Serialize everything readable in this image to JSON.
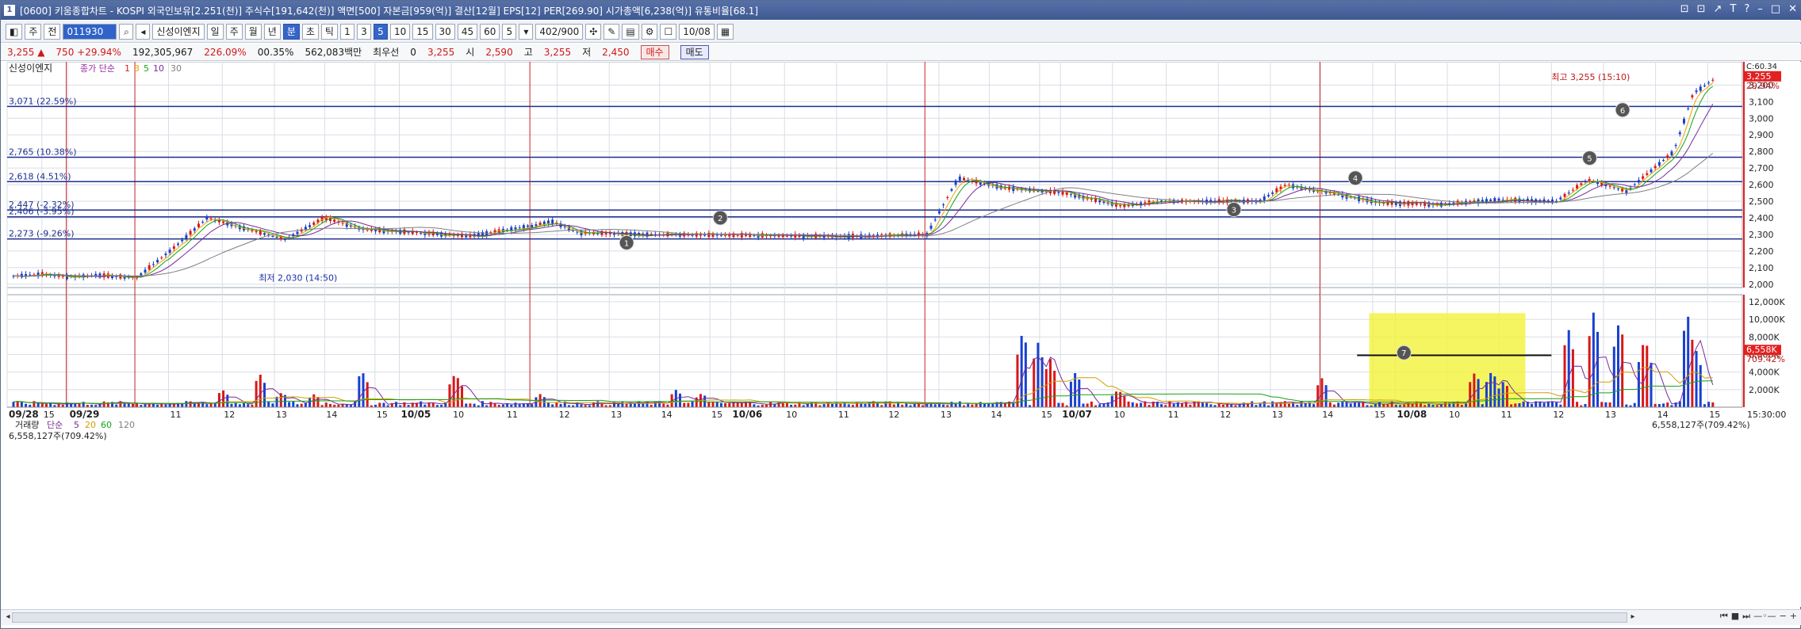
{
  "window": {
    "title": "[0600] 키움종합차트 - KOSPI 외국인보유[2.251(천)] 주식수[191,642(천)] 액면[500] 자본금[959(억)] 결산[12월] EPS[12] PER[269.90] 시가총액[6,238(억)] 유통비율[68.1]",
    "badge": "1",
    "controls": [
      "⊡",
      "⊡",
      "↗",
      "T",
      "?",
      "–",
      "□",
      "✕"
    ]
  },
  "toolbar": {
    "items": [
      "주",
      "전",
      "011930",
      "신성이엔지",
      "일",
      "주",
      "월",
      "년",
      "분",
      "초",
      "틱",
      "1",
      "3",
      "5",
      "10",
      "15",
      "30",
      "45",
      "60",
      "5",
      "402/900",
      "10/08"
    ],
    "selected_period": "분",
    "selected_value": "5"
  },
  "quote": {
    "price": "3,255",
    "arrow": "▲",
    "change": "750 +29.94%",
    "volume": "192,305,967",
    "vol_ratio": "226.09%",
    "turnover": "00.35%",
    "amount": "562,083백만",
    "priority": "최우선",
    "bid": "0",
    "ask": "3,255",
    "open_label": "시",
    "open": "2,590",
    "high_label": "고",
    "high": "3,255",
    "low_label": "저",
    "low": "2,450",
    "buy": "매수",
    "sell": "매도"
  },
  "chart_data": [
    {
      "type": "candlestick",
      "title": "신성이엔지",
      "ma_legend": [
        "종가 단순",
        "1",
        "3",
        "5",
        "10",
        "30"
      ],
      "ma_colors": [
        "#d62020",
        "#f0a000",
        "#18a018",
        "#7a2a9a",
        "#808080"
      ],
      "yticks": [
        2000,
        2100,
        2200,
        2300,
        2400,
        2500,
        2600,
        2700,
        2800,
        2900,
        3000,
        3100,
        3200
      ],
      "ylim": [
        1980,
        3340
      ],
      "right_labels": [
        "C:60.34",
        "3,255",
        "29.94%"
      ],
      "levels": [
        {
          "value": 3071,
          "label": "3,071 (22.59%)"
        },
        {
          "value": 2765,
          "label": "2,765 (10.38%)"
        },
        {
          "value": 2618,
          "label": "2,618 (4.51%)"
        },
        {
          "value": 2447,
          "label": "2,447 (-2.32%)"
        },
        {
          "value": 2406,
          "label": "2,406 (-3.95%)"
        },
        {
          "value": 2273,
          "label": "2,273 (-9.26%)"
        }
      ],
      "annotations": {
        "high": "최고 3,255 (15:10)",
        "low": "최저 2,030 (14:50)",
        "markers": [
          "1",
          "2",
          "3",
          "4",
          "5",
          "6"
        ]
      },
      "days": [
        {
          "label": "09/28",
          "n": 30,
          "path": [
            [
              0,
              2050
            ],
            [
              0.25,
              2062
            ],
            [
              0.45,
              2045
            ],
            [
              0.7,
              2055
            ],
            [
              1,
              2040
            ]
          ]
        },
        {
          "label": "10/05",
          "n": 96,
          "path": [
            [
              0,
              2040
            ],
            [
              0.1,
              2230
            ],
            [
              0.18,
              2400
            ],
            [
              0.3,
              2320
            ],
            [
              0.38,
              2270
            ],
            [
              0.48,
              2400
            ],
            [
              0.58,
              2330
            ],
            [
              0.72,
              2310
            ],
            [
              0.85,
              2290
            ],
            [
              1,
              2350
            ]
          ]
        },
        {
          "label": "10/06",
          "n": 96,
          "path": [
            [
              0,
              2350
            ],
            [
              0.05,
              2380
            ],
            [
              0.12,
              2310
            ],
            [
              0.3,
              2300
            ],
            [
              0.7,
              2290
            ],
            [
              0.85,
              2290
            ],
            [
              1,
              2300
            ]
          ]
        },
        {
          "label": "10/07",
          "n": 96,
          "path": [
            [
              0,
              2300
            ],
            [
              0.08,
              2640
            ],
            [
              0.2,
              2580
            ],
            [
              0.35,
              2550
            ],
            [
              0.5,
              2470
            ],
            [
              0.6,
              2500
            ],
            [
              0.85,
              2500
            ],
            [
              0.92,
              2600
            ],
            [
              1,
              2560
            ]
          ]
        },
        {
          "label": "10/08",
          "n": 96,
          "path": [
            [
              0,
              2560
            ],
            [
              0.15,
              2490
            ],
            [
              0.3,
              2480
            ],
            [
              0.45,
              2510
            ],
            [
              0.6,
              2500
            ],
            [
              0.68,
              2630
            ],
            [
              0.78,
              2560
            ],
            [
              0.9,
              2800
            ],
            [
              0.95,
              3150
            ],
            [
              1,
              3230
            ]
          ]
        }
      ],
      "candle_colors": {
        "up": "#d81818",
        "down": "#1840d0"
      }
    },
    {
      "type": "bar",
      "title": "거래량",
      "ma_legend": [
        "단순",
        "5",
        "20",
        "60",
        "120"
      ],
      "ma_colors": [
        "#7a2a9a",
        "#d0a000",
        "#18a018",
        "#808080"
      ],
      "current": "6,558,127주(709.42%)",
      "yticks": [
        "2,000K",
        "4,000K",
        "6,000K",
        "8,000K",
        "10,000K",
        "12,000K"
      ],
      "ytick_values": [
        2000,
        4000,
        6000,
        8000,
        10000,
        12000
      ],
      "ylim": [
        0,
        12800
      ],
      "right_labels": [
        "6,558K",
        "709.42%"
      ],
      "highlight_marker": "7",
      "peaks": [
        {
          "at": 0.123,
          "v": 2000
        },
        {
          "at": 0.145,
          "v": 3800
        },
        {
          "at": 0.158,
          "v": 1700
        },
        {
          "at": 0.177,
          "v": 1500
        },
        {
          "at": 0.205,
          "v": 4200
        },
        {
          "at": 0.26,
          "v": 3900
        },
        {
          "at": 0.31,
          "v": 1500
        },
        {
          "at": 0.39,
          "v": 2000
        },
        {
          "at": 0.405,
          "v": 1600
        },
        {
          "at": 0.594,
          "v": 8800
        },
        {
          "at": 0.603,
          "v": 7400
        },
        {
          "at": 0.61,
          "v": 5600
        },
        {
          "at": 0.625,
          "v": 4000
        },
        {
          "at": 0.65,
          "v": 2000
        },
        {
          "at": 0.77,
          "v": 3300
        },
        {
          "at": 0.86,
          "v": 4000
        },
        {
          "at": 0.87,
          "v": 4200
        },
        {
          "at": 0.877,
          "v": 3000
        },
        {
          "at": 0.915,
          "v": 9000
        },
        {
          "at": 0.93,
          "v": 11000
        },
        {
          "at": 0.945,
          "v": 10000
        },
        {
          "at": 0.96,
          "v": 8000
        },
        {
          "at": 0.985,
          "v": 10800
        },
        {
          "at": 0.99,
          "v": 6600
        }
      ]
    }
  ],
  "x_axis": {
    "labels": [
      {
        "at": 0.0,
        "text": "09/28"
      },
      {
        "at": 0.02,
        "text": "15"
      },
      {
        "at": 0.035,
        "text": "09/29"
      },
      {
        "at": 0.093,
        "text": "11"
      },
      {
        "at": 0.124,
        "text": "12"
      },
      {
        "at": 0.154,
        "text": "13"
      },
      {
        "at": 0.183,
        "text": "14"
      },
      {
        "at": 0.212,
        "text": "15"
      },
      {
        "at": 0.226,
        "text": "10/05"
      },
      {
        "at": 0.256,
        "text": "10"
      },
      {
        "at": 0.287,
        "text": "11"
      },
      {
        "at": 0.317,
        "text": "12"
      },
      {
        "at": 0.347,
        "text": "13"
      },
      {
        "at": 0.376,
        "text": "14"
      },
      {
        "at": 0.405,
        "text": "15"
      },
      {
        "at": 0.417,
        "text": "10/06"
      },
      {
        "at": 0.448,
        "text": "10"
      },
      {
        "at": 0.478,
        "text": "11"
      },
      {
        "at": 0.507,
        "text": "12"
      },
      {
        "at": 0.537,
        "text": "13"
      },
      {
        "at": 0.566,
        "text": "14"
      },
      {
        "at": 0.595,
        "text": "15"
      },
      {
        "at": 0.607,
        "text": "10/07"
      },
      {
        "at": 0.637,
        "text": "10"
      },
      {
        "at": 0.668,
        "text": "11"
      },
      {
        "at": 0.698,
        "text": "12"
      },
      {
        "at": 0.728,
        "text": "13"
      },
      {
        "at": 0.757,
        "text": "14"
      },
      {
        "at": 0.787,
        "text": "15"
      },
      {
        "at": 0.8,
        "text": "10/08"
      },
      {
        "at": 0.83,
        "text": "10"
      },
      {
        "at": 0.86,
        "text": "11"
      },
      {
        "at": 0.89,
        "text": "12"
      },
      {
        "at": 0.92,
        "text": "13"
      },
      {
        "at": 0.95,
        "text": "14"
      },
      {
        "at": 0.98,
        "text": "15"
      }
    ],
    "time": "15:30:00"
  },
  "colors": {
    "session_line": "#c82020",
    "level_line": "#1d2f8f",
    "highlight": "#f3f33a",
    "grid": "#d9dde5",
    "axis_bar": "#e42020"
  }
}
